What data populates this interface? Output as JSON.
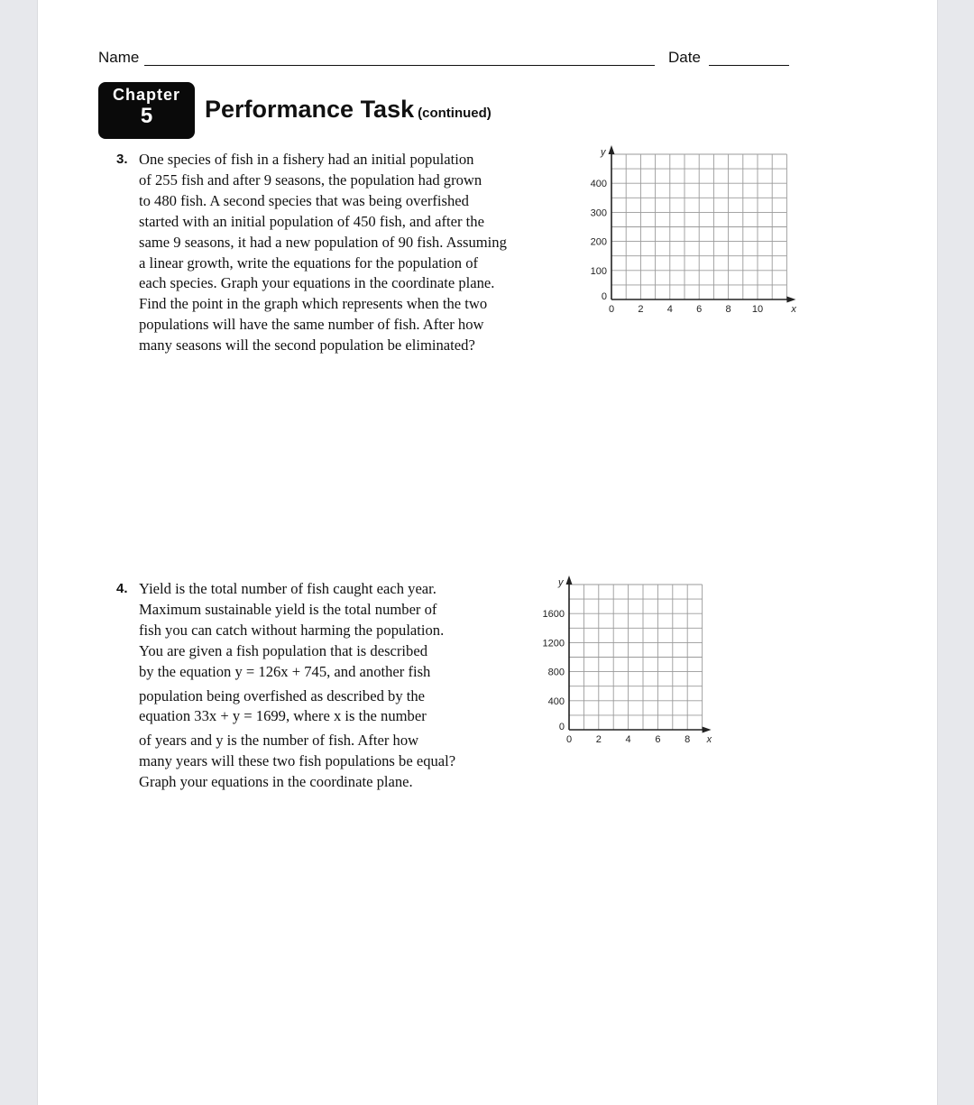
{
  "header": {
    "name_label": "Name",
    "date_label": "Date",
    "chapter_word": "Chapter",
    "chapter_number": "5",
    "title": "Performance Task",
    "title_suffix": "(continued)"
  },
  "problems": [
    {
      "number": "3.",
      "lines": [
        "One species of fish in a fishery had an initial population",
        "of 255 fish and after 9 seasons, the population had grown",
        "to 480 fish. A second species that was being overfished",
        "started with an initial population of 450 fish, and after the",
        "same 9 seasons, it had a new population of 90 fish. Assuming",
        "a linear growth, write the equations for the population of",
        "each species. Graph your equations in the coordinate plane.",
        "Find the point in the graph which represents when the two",
        "populations will have the same number of fish. After how",
        "many seasons will the second population be eliminated?"
      ]
    },
    {
      "number": "4.",
      "lines": [
        "Yield is the total number of fish caught each year.",
        "Maximum sustainable yield is the total number of",
        "fish you can catch without harming the population.",
        "You are given a fish population that is described",
        "by the equation  y  =  126x  +  745, and another fish",
        "population being overfished as described by the",
        "equation  33x  +  y  =  1699, where x is the number",
        "of years and y is the number of fish. After how",
        "many years will these two fish populations be equal?",
        "Graph your equations in the coordinate plane."
      ]
    }
  ],
  "chart_data": [
    {
      "type": "line",
      "title": "",
      "xlabel": "x",
      "ylabel": "y",
      "xlim": [
        0,
        12
      ],
      "ylim": [
        0,
        500
      ],
      "x_grid_step": 1,
      "y_grid_step": 50,
      "grid": true,
      "x_ticks": [
        0,
        2,
        4,
        6,
        8,
        10
      ],
      "y_ticks": [
        0,
        100,
        200,
        300,
        400
      ],
      "series": []
    },
    {
      "type": "line",
      "title": "",
      "xlabel": "x",
      "ylabel": "y",
      "xlim": [
        0,
        9
      ],
      "ylim": [
        0,
        2000
      ],
      "x_grid_step": 1,
      "y_grid_step": 200,
      "grid": true,
      "x_ticks": [
        0,
        2,
        4,
        6,
        8
      ],
      "y_ticks": [
        0,
        400,
        800,
        1200,
        1600
      ],
      "series": []
    }
  ]
}
